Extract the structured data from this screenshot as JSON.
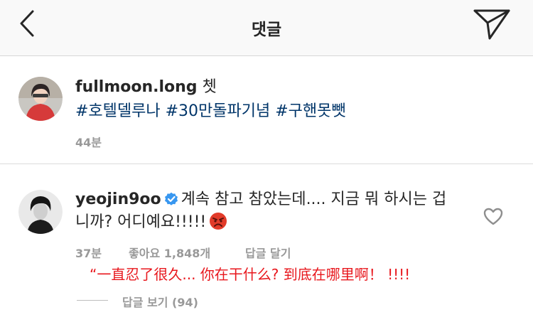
{
  "header": {
    "title": "댓글"
  },
  "caption": {
    "username": "fullmoon.long",
    "text": "쳇",
    "hashtags": "#호텔델루나 #30만돌파기념 #구핸못뺏",
    "time": "44분"
  },
  "comment": {
    "username": "yeojin9oo",
    "text_line1": "계속 참고 참았는데.... 지금 뭐 하시는 겁",
    "text_line2": "니까? 어디예요!!!!!",
    "time": "37분",
    "likes": "좋아요 1,848개",
    "reply_label": "답글 달기",
    "view_replies": "답글 보기 (94)"
  },
  "translation": "“一直忍了很久... 你在干什么? 到底在哪里啊！ !!!!",
  "icons": {
    "back": "chevron-left-icon",
    "share": "send-icon",
    "verified": "verified-badge-icon",
    "emoji": "angry-face-icon",
    "like": "heart-icon"
  },
  "colors": {
    "hashtag": "#003569",
    "meta": "#999999",
    "verified": "#3897f0",
    "translation": "#e8171d",
    "angry": "#e23b2a"
  }
}
